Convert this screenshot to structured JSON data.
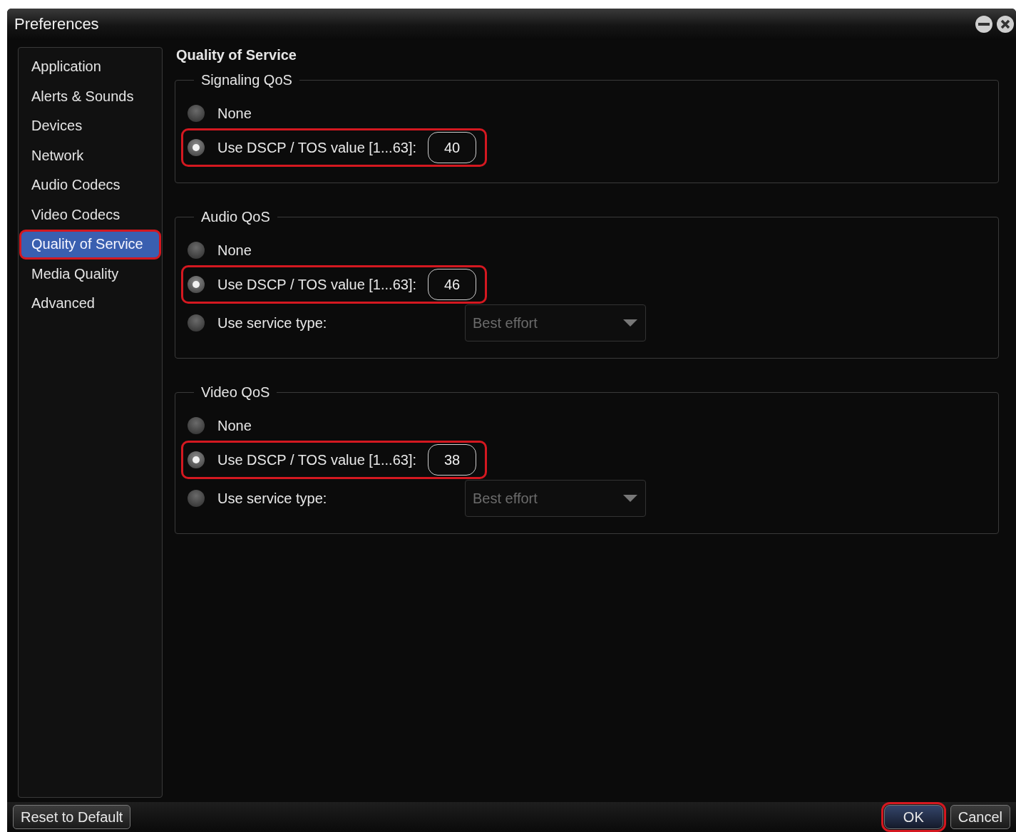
{
  "window": {
    "title": "Preferences"
  },
  "sidebar": {
    "items": [
      {
        "label": "Application",
        "selected": false,
        "highlighted": false
      },
      {
        "label": "Alerts & Sounds",
        "selected": false,
        "highlighted": false
      },
      {
        "label": "Devices",
        "selected": false,
        "highlighted": false
      },
      {
        "label": "Network",
        "selected": false,
        "highlighted": false
      },
      {
        "label": "Audio Codecs",
        "selected": false,
        "highlighted": false
      },
      {
        "label": "Video Codecs",
        "selected": false,
        "highlighted": false
      },
      {
        "label": "Quality of Service",
        "selected": true,
        "highlighted": true
      },
      {
        "label": "Media Quality",
        "selected": false,
        "highlighted": false
      },
      {
        "label": "Advanced",
        "selected": false,
        "highlighted": false
      }
    ]
  },
  "panel": {
    "title": "Quality of Service",
    "groups": [
      {
        "title": "Signaling QoS",
        "options": [
          {
            "kind": "plain",
            "label": "None",
            "selected": false,
            "highlighted": false
          },
          {
            "kind": "number",
            "label": "Use DSCP / TOS value [1...63]:",
            "value": "40",
            "selected": true,
            "highlighted": true
          }
        ]
      },
      {
        "title": "Audio QoS",
        "options": [
          {
            "kind": "plain",
            "label": "None",
            "selected": false,
            "highlighted": false
          },
          {
            "kind": "number",
            "label": "Use DSCP / TOS value [1...63]:",
            "value": "46",
            "selected": true,
            "highlighted": true
          },
          {
            "kind": "select",
            "label": "Use service type:",
            "value": "Best effort",
            "disabled": true,
            "selected": false,
            "highlighted": false
          }
        ]
      },
      {
        "title": "Video QoS",
        "options": [
          {
            "kind": "plain",
            "label": "None",
            "selected": false,
            "highlighted": false
          },
          {
            "kind": "number",
            "label": "Use DSCP / TOS value [1...63]:",
            "value": "38",
            "selected": true,
            "highlighted": true
          },
          {
            "kind": "select",
            "label": "Use service type:",
            "value": "Best effort",
            "disabled": true,
            "selected": false,
            "highlighted": false
          }
        ]
      }
    ]
  },
  "footer": {
    "buttons": [
      {
        "kind": "left",
        "label": "Reset to Default",
        "highlighted": false
      },
      {
        "kind": "right",
        "label": "OK",
        "highlighted": true
      },
      {
        "kind": "right",
        "label": "Cancel",
        "highlighted": false
      }
    ]
  }
}
